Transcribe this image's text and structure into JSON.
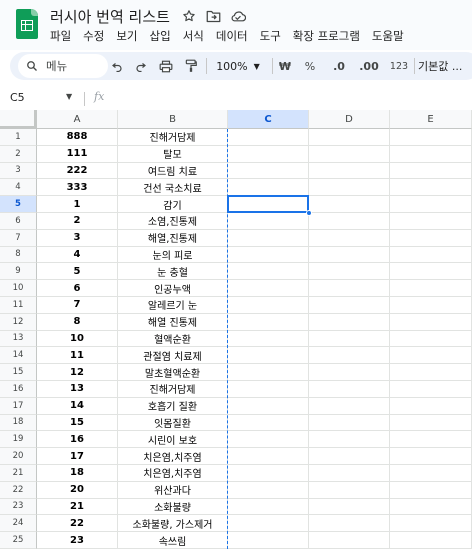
{
  "document": {
    "title": "러시아 번역 리스트"
  },
  "menu": [
    "파일",
    "수정",
    "보기",
    "삽입",
    "서식",
    "데이터",
    "도구",
    "확장 프로그램",
    "도움말"
  ],
  "toolbar": {
    "search_placeholder": "메뉴",
    "zoom": "100%",
    "currency": "₩",
    "percent": "%",
    "decrease_decimal": ".0",
    "increase_decimal": ".00",
    "number_format": "123",
    "font": "기본값 ..."
  },
  "formula_bar": {
    "cell_ref": "C5",
    "fx": "fx",
    "content": ""
  },
  "sheet": {
    "columns": [
      "A",
      "B",
      "C",
      "D",
      "E"
    ],
    "selected_column": "C",
    "selected_row": 5,
    "rows": [
      {
        "n": "1",
        "a": "888",
        "b": "진해거담제"
      },
      {
        "n": "2",
        "a": "111",
        "b": "탈모"
      },
      {
        "n": "3",
        "a": "222",
        "b": "여드림 치료"
      },
      {
        "n": "4",
        "a": "333",
        "b": "건선 국소치료"
      },
      {
        "n": "5",
        "a": "1",
        "b": "감기"
      },
      {
        "n": "6",
        "a": "2",
        "b": "소염,진통제"
      },
      {
        "n": "7",
        "a": "3",
        "b": "해열,진통제"
      },
      {
        "n": "8",
        "a": "4",
        "b": "눈의 피로"
      },
      {
        "n": "9",
        "a": "5",
        "b": "눈 충혈"
      },
      {
        "n": "10",
        "a": "6",
        "b": "인공누액"
      },
      {
        "n": "11",
        "a": "7",
        "b": "알레르기 눈"
      },
      {
        "n": "12",
        "a": "8",
        "b": "해열 진통제"
      },
      {
        "n": "13",
        "a": "10",
        "b": "혈액순환"
      },
      {
        "n": "14",
        "a": "11",
        "b": "관절염 치료제"
      },
      {
        "n": "15",
        "a": "12",
        "b": "말초혈액순환"
      },
      {
        "n": "16",
        "a": "13",
        "b": "진해거담제"
      },
      {
        "n": "17",
        "a": "14",
        "b": "호흡기 질환"
      },
      {
        "n": "18",
        "a": "15",
        "b": "잇몸질환"
      },
      {
        "n": "19",
        "a": "16",
        "b": "시린이 보호"
      },
      {
        "n": "20",
        "a": "17",
        "b": "치은염,치주염"
      },
      {
        "n": "21",
        "a": "18",
        "b": "치은염,치주염"
      },
      {
        "n": "22",
        "a": "20",
        "b": "위산과다"
      },
      {
        "n": "23",
        "a": "21",
        "b": "소화불량"
      },
      {
        "n": "24",
        "a": "22",
        "b": "소화불량, 가스제거"
      },
      {
        "n": "25",
        "a": "23",
        "b": "속쓰림"
      }
    ]
  }
}
